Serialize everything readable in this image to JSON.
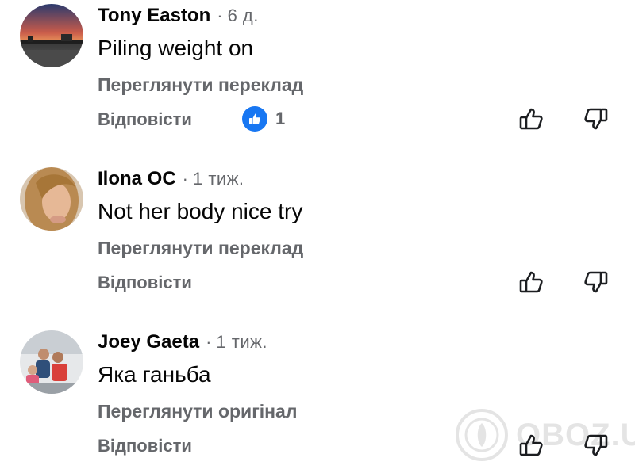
{
  "comments": [
    {
      "author": "Tony Easton",
      "separator": "·",
      "time": "6 д.",
      "text": "Piling weight on",
      "translation_link": "Переглянути переклад",
      "reply_label": "Відповісти",
      "reaction": {
        "icon": "like-icon",
        "count": "1"
      }
    },
    {
      "author": "Ilona OC",
      "separator": "·",
      "time": "1 тиж.",
      "text": "Not her body nice try",
      "translation_link": "Переглянути переклад",
      "reply_label": "Відповісти"
    },
    {
      "author": "Joey Gaeta",
      "separator": "·",
      "time": "1 тиж.",
      "text": "Яка ганьба",
      "translation_link": "Переглянути оригінал",
      "reply_label": "Відповісти"
    }
  ],
  "watermark": {
    "text": "OBOZ.UA"
  },
  "colors": {
    "text_primary": "#050505",
    "text_secondary": "#65676b",
    "like_blue": "#1877f2"
  }
}
